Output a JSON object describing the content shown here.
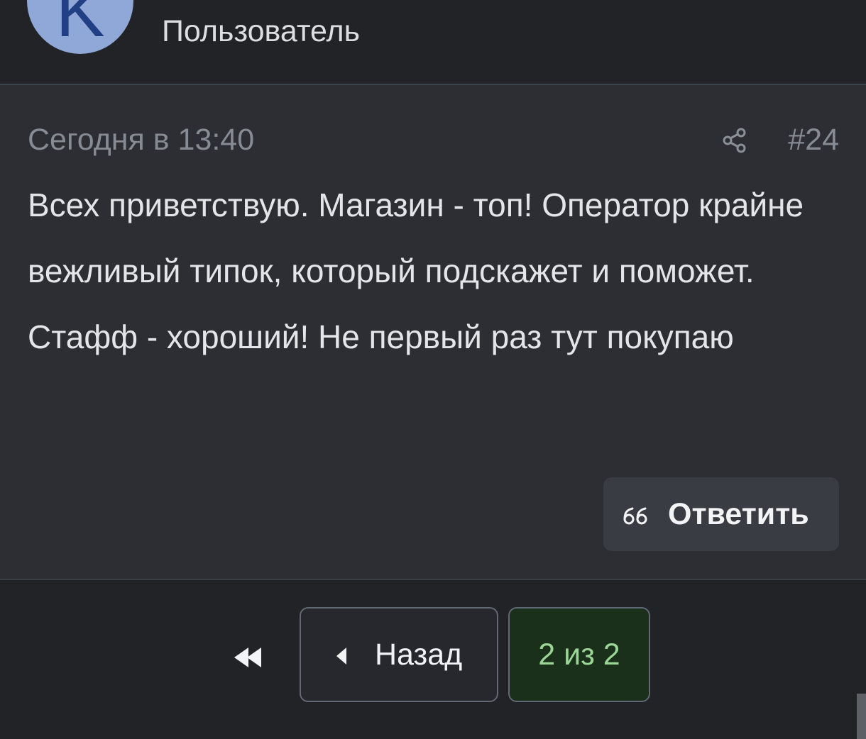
{
  "header": {
    "avatar_letter": "K",
    "user_title": "Пользователь"
  },
  "post": {
    "date": "Сегодня в 13:40",
    "share_icon": "share-icon",
    "number": "#24",
    "body": "Всех приветствую. Магазин - топ! Оператор крайне вежливый типок, который подскажет и поможет. Стафф - хороший! Не первый раз тут покупаю",
    "reply_icon": "quote-icon",
    "reply_label": "Ответить"
  },
  "pagination": {
    "first_icon": "double-chevron-left-icon",
    "prev_icon": "caret-left-icon",
    "prev_label": "Назад",
    "page_label": "2 из 2"
  },
  "colors": {
    "background": "#222327",
    "post_background": "#2c2e33",
    "avatar": "#8fa8d8",
    "page_indicator": "#1b301b",
    "page_text": "#9bd696"
  }
}
